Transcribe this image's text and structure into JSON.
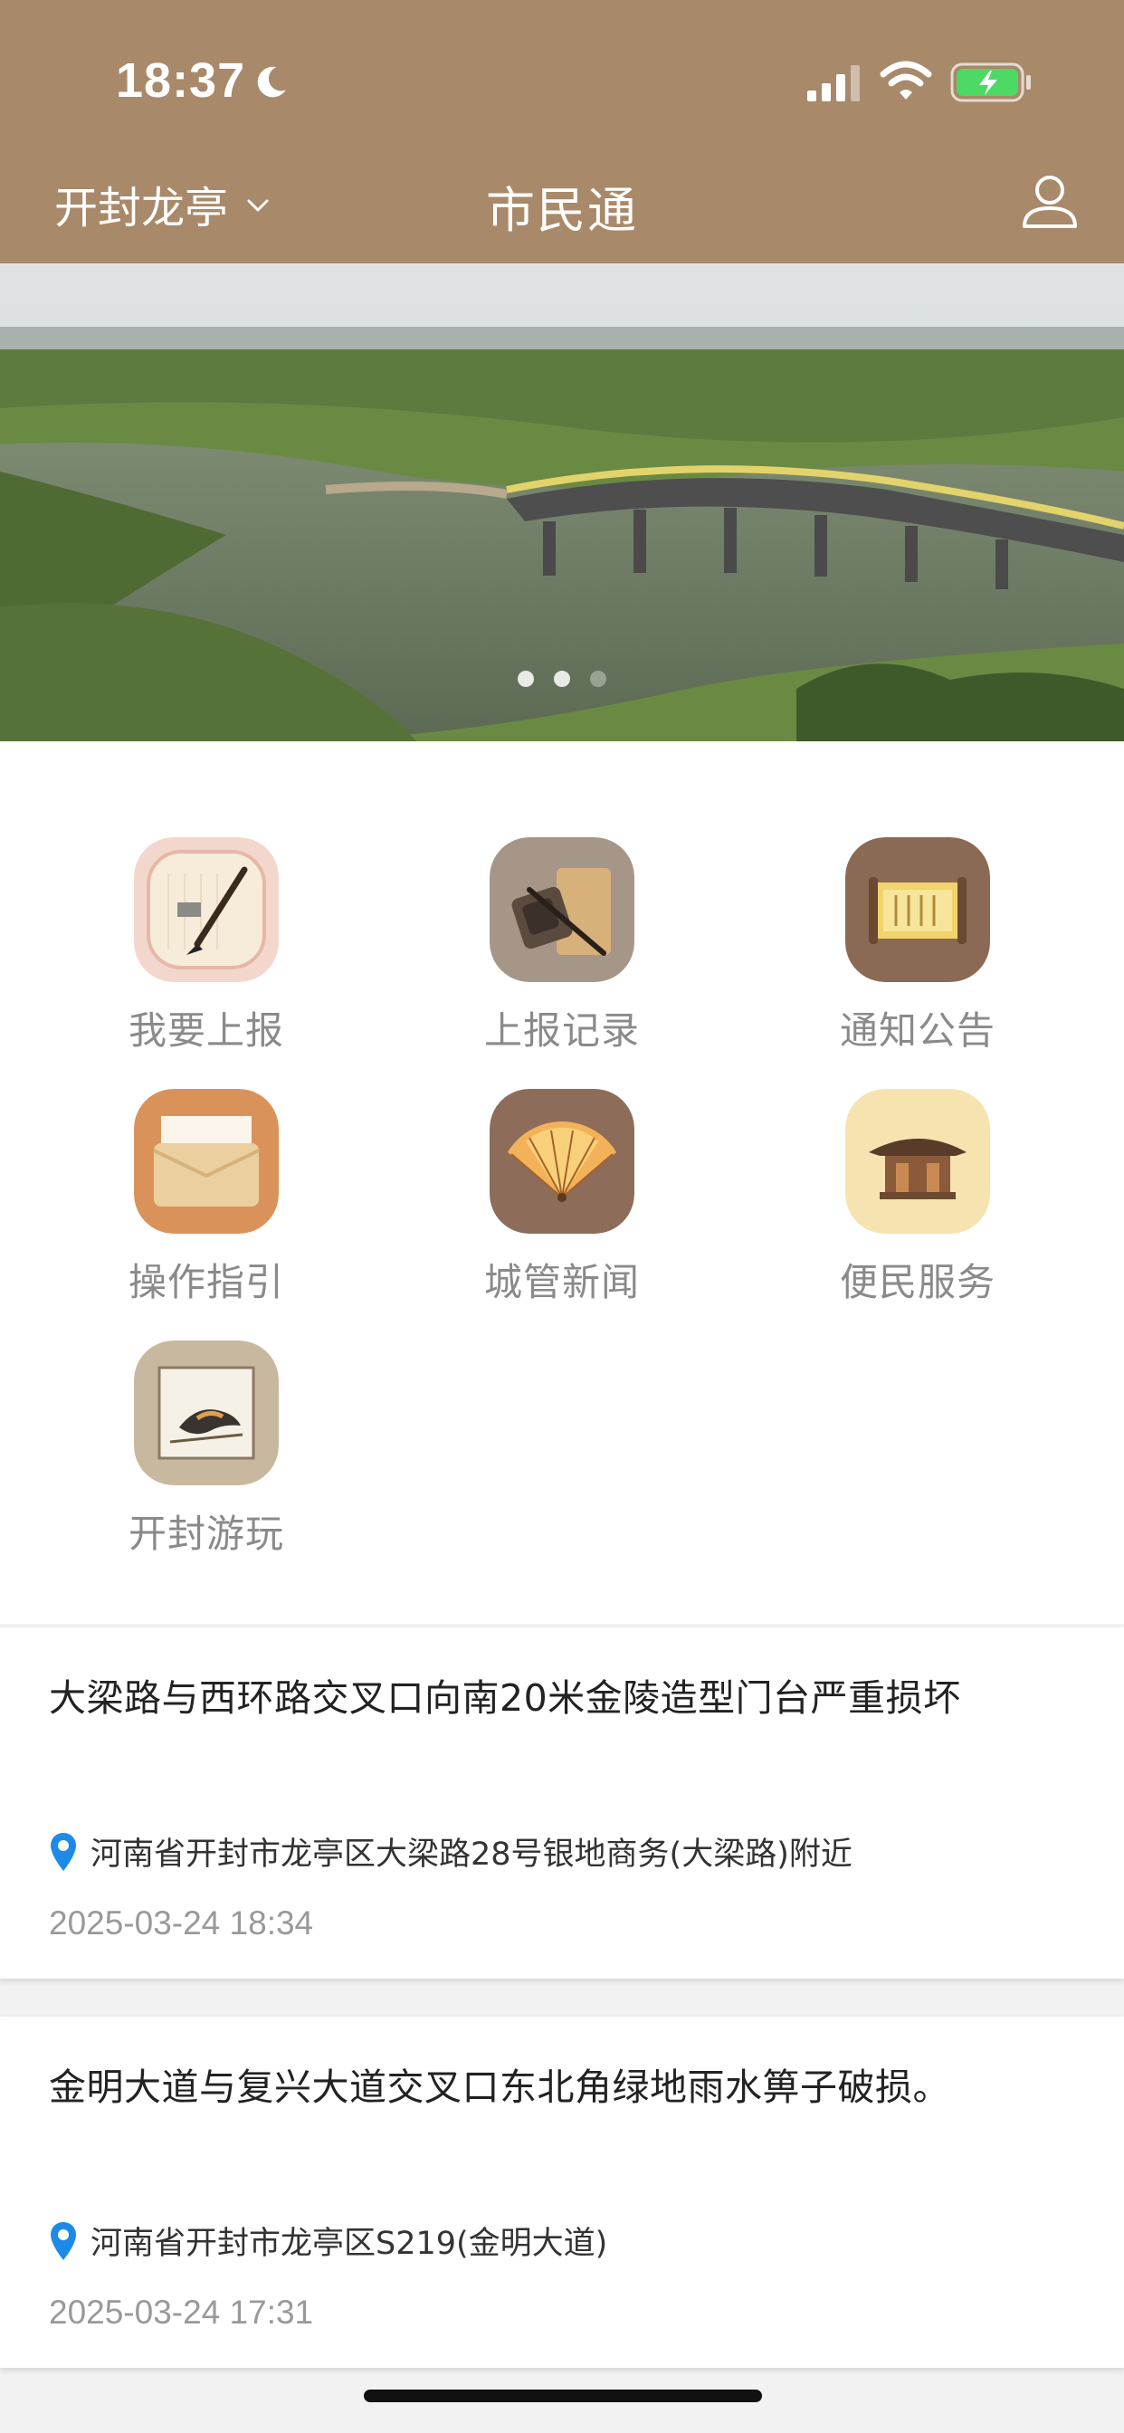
{
  "status_bar": {
    "time": "18:37",
    "icons": [
      "moon-icon",
      "signal-icon",
      "wifi-icon",
      "battery-charging-icon"
    ]
  },
  "header": {
    "city": "开封龙亭",
    "title": "市民通",
    "user_icon": "user-icon",
    "color": "#a8896a"
  },
  "banner": {
    "slides": 3,
    "active_index": 2
  },
  "menu": {
    "items": [
      {
        "label": "我要上报",
        "icon": "brush-paper-icon"
      },
      {
        "label": "上报记录",
        "icon": "ink-stone-icon"
      },
      {
        "label": "通知公告",
        "icon": "scroll-icon"
      },
      {
        "label": "操作指引",
        "icon": "envelope-icon"
      },
      {
        "label": "城管新闻",
        "icon": "folding-fan-icon"
      },
      {
        "label": "便民服务",
        "icon": "pavilion-icon"
      },
      {
        "label": "开封游玩",
        "icon": "bird-painting-icon"
      }
    ]
  },
  "reports": [
    {
      "title": "大梁路与西环路交叉口向南20米金陵造型门台严重损坏",
      "location": "河南省开封市龙亭区大梁路28号银地商务(大梁路)附近",
      "time": "2025-03-24 18:34"
    },
    {
      "title": "金明大道与复兴大道交叉口东北角绿地雨水箅子破损。",
      "location": "河南省开封市龙亭区S219(金明大道)",
      "time": "2025-03-24 17:31"
    }
  ]
}
